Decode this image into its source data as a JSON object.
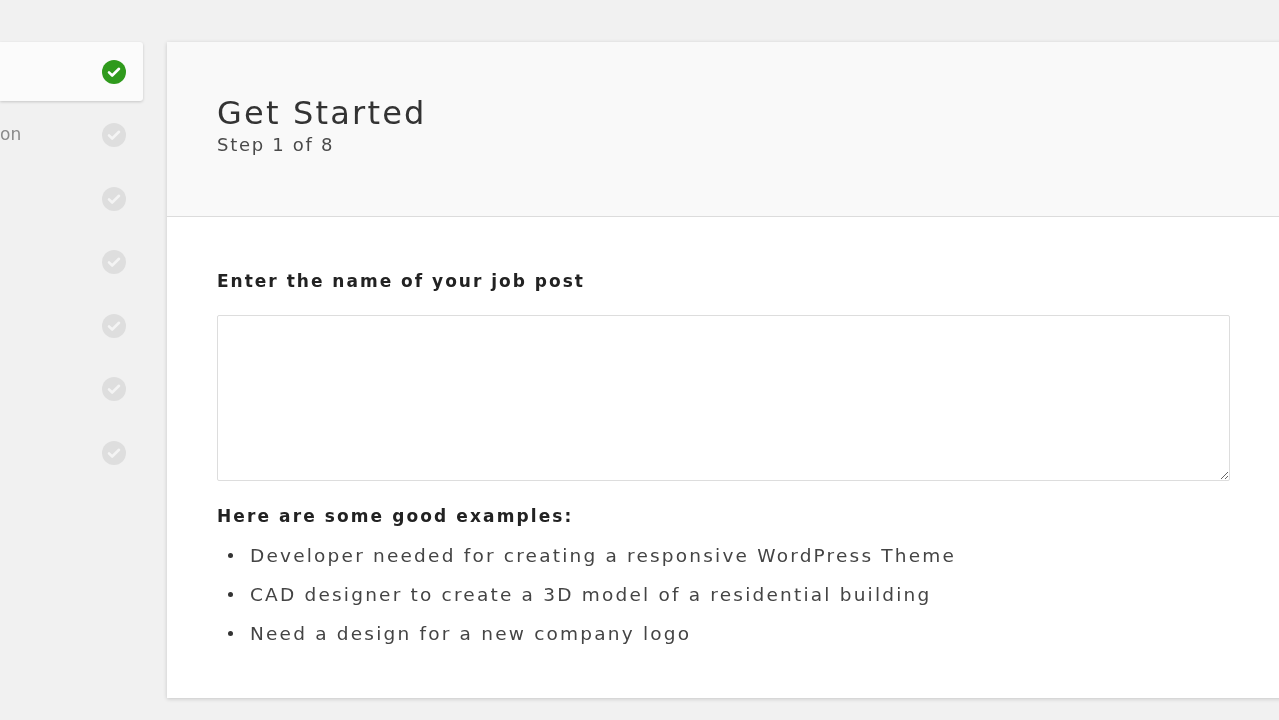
{
  "sidebar": {
    "steps": [
      {
        "selected": true,
        "done": true
      },
      {
        "label": "on",
        "selected": false,
        "done": false
      },
      {
        "selected": false,
        "done": false
      },
      {
        "selected": false,
        "done": false
      },
      {
        "selected": false,
        "done": false
      },
      {
        "selected": false,
        "done": false
      },
      {
        "selected": false,
        "done": false
      }
    ]
  },
  "header": {
    "title": "Get Started",
    "step": "Step 1 of 8"
  },
  "form": {
    "field": {
      "label": "Enter the name of your job post"
    },
    "examples": {
      "heading": "Here are some good examples:",
      "items": [
        "Developer needed for creating a responsive WordPress Theme",
        "CAD designer to create a 3D model of a residential building",
        "Need a design for a new company logo"
      ]
    }
  }
}
